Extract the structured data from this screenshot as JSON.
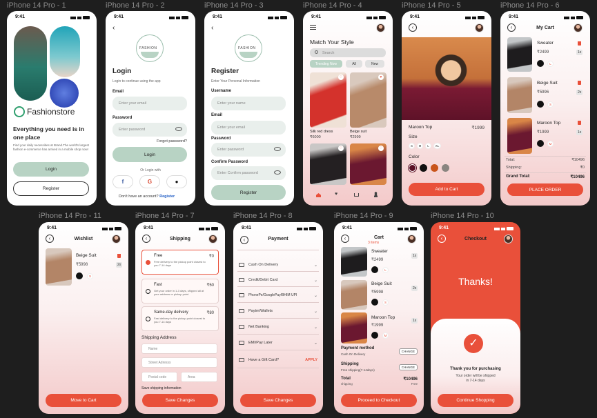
{
  "labels": [
    "iPhone 14 Pro - 1",
    "iPhone 14 Pro - 2",
    "iPhone 14 Pro - 3",
    "iPhone 14 Pro - 4",
    "iPhone 14 Pro - 5",
    "iPhone 14 Pro - 6",
    "iPhone 14 Pro - 11",
    "iPhone 14 Pro - 7",
    "iPhone 14 Pro - 8",
    "iPhone 14 Pro - 9",
    "iPhone 14 Pro - 10"
  ],
  "time": "9:41",
  "colors": {
    "accent": "#e9503a",
    "mint": "#b8d3c4",
    "field": "#e9efec"
  },
  "s1": {
    "brand": "Fashionstore",
    "headline": "Everything you need is in one place",
    "desc": "Find your daily necessities at Brand.The world's largest fashion e-commerce has arrived in a mobile shop now!",
    "login": "Login",
    "register": "Register"
  },
  "logo_text": "FASHION",
  "s2": {
    "title": "Login",
    "sub": "Login to continue using the app",
    "email_label": "Email",
    "email_ph": "Enter your email",
    "pw_label": "Password",
    "pw_ph": "Enter password",
    "forgot": "Forgot password?",
    "login": "Login",
    "or": "Or Login with",
    "no_account": "Don't have an account?",
    "register_link": "Register"
  },
  "s3": {
    "title": "Register",
    "sub": "Enter Your Personal Information",
    "f1": "Username",
    "f1_ph": "Enter your name",
    "f2": "Email",
    "f2_ph": "Enter your email",
    "f3": "Password",
    "f3_ph": "Enter password",
    "f4": "Confirm Password",
    "f4_ph": "Enter Confirm password",
    "btn": "Register"
  },
  "s4": {
    "title": "Match Your Style",
    "search": "Search",
    "chips": [
      "Trending Now",
      "All",
      "New"
    ],
    "products": [
      {
        "name": "Silk red  dress",
        "price": "₹6000"
      },
      {
        "name": "Beige suit",
        "price": "₹2999"
      }
    ]
  },
  "s5": {
    "name": "Maroon Top",
    "price": "₹1999",
    "size_label": "Size",
    "sizes": [
      "S",
      "M",
      "L",
      "XL"
    ],
    "color_label": "Color",
    "colors": [
      "#5a0f24",
      "#111111",
      "#c9541a",
      "#8a8580"
    ],
    "btn": "Add to Cart"
  },
  "s6": {
    "title": "My Cart",
    "items": [
      {
        "name": "Sweater",
        "price": "₹2499",
        "size": "L",
        "qty": "1x"
      },
      {
        "name": "Beige Suit",
        "price": "₹5996",
        "size": "S",
        "qty": "2x"
      },
      {
        "name": "Maroon Top",
        "price": "₹1999",
        "size": "M",
        "qty": "1x"
      }
    ],
    "total_label": "Total:",
    "total": "₹10496",
    "ship_label": "Shipping:",
    "ship": "₹0",
    "grand_label": "Grand Total:",
    "grand": "₹10496",
    "btn": "PLACE ORDER"
  },
  "s11": {
    "title": "Wishlist",
    "item": {
      "name": "Beige Suit",
      "price": "₹5998",
      "size": "S",
      "qty": "2x"
    },
    "btn": "Move to Cart"
  },
  "s7": {
    "title": "Shipping",
    "options": [
      {
        "name": "Free",
        "price": "₹0",
        "desc": "Free delivery to the pickup point closest to you 7-14 days"
      },
      {
        "name": "Fast",
        "price": "₹50",
        "desc": "Get your order in 1-3 days, shipped all at your address or pickup point"
      },
      {
        "name": "Same-day delivery",
        "price": "₹80",
        "desc": "Fast delivery to the pickup point closest to you 7-14 days"
      }
    ],
    "addr_title": "Shipping Address",
    "name_ph": "Name",
    "street_ph": "Street Adresss",
    "postal_ph": "Postal code",
    "area_ph": "Area",
    "info": "Save shipping information",
    "btn": "Save Changes"
  },
  "s8": {
    "title": "Payment",
    "methods": [
      "Cash On Delivery",
      "Credit/Debit Card",
      "PhonePe/GooglePay/BHIM UPI",
      "Paytm/Wallets",
      "Net Banking",
      "EMI/Pay Later"
    ],
    "gift": "Have a Gift Card?",
    "apply": "APPLY",
    "btn": "Save Changes"
  },
  "s9": {
    "title": "Cart",
    "count": "3 items",
    "items": [
      {
        "name": "Sweater",
        "price": "₹2499",
        "size": "L",
        "qty": "1x"
      },
      {
        "name": "Beige Suit",
        "price": "₹5998",
        "size": "S",
        "qty": "2x"
      },
      {
        "name": "Maroon Top",
        "price": "₹1999",
        "size": "M",
        "qty": "1x"
      }
    ],
    "pm_label": "Payment method",
    "pm_val": "Cash On Delivery",
    "change": "CHANGE",
    "sh_label": "Shipping",
    "sh_val": "Free shipping(7-14days)",
    "total_label": "Total",
    "total": "₹10496",
    "sub": "shipping",
    "free": "Free",
    "btn": "Proceed to Checkout"
  },
  "s10": {
    "title": "Checkout",
    "thanks": "Thanks!",
    "msg1": "Thank you for purchasing",
    "msg2": "Your order will be shipped",
    "msg3": "in 7-14 days",
    "btn": "Continue Shopping"
  }
}
